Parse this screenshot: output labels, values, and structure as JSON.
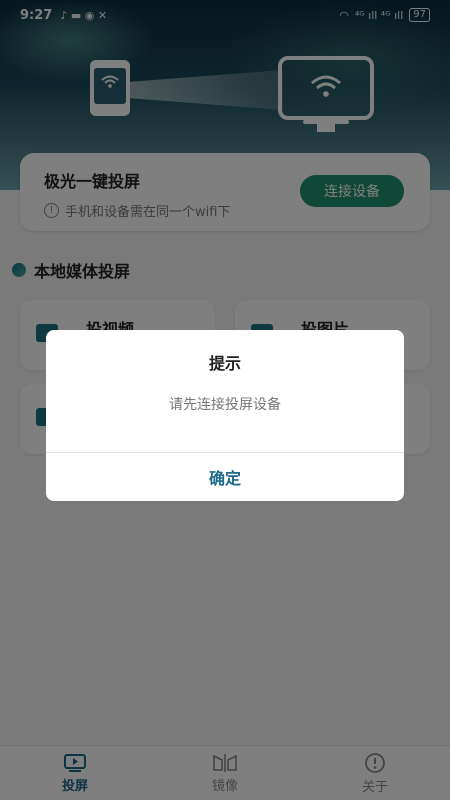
{
  "status_bar": {
    "time": "9:27",
    "mini_icons": "♪ ▬ ◉ ✕",
    "signal_text": "⁴ᴳ ıll ⁴ᴳ ıll",
    "battery": "97"
  },
  "header_card": {
    "title": "极光一键投屏",
    "tip": "手机和设备需在同一个wifi下",
    "connect_label": "连接设备"
  },
  "section": {
    "title": "本地媒体投屏"
  },
  "tiles": [
    {
      "label": "投视频"
    },
    {
      "label": "投图片"
    },
    {
      "label": ""
    },
    {
      "label": ""
    }
  ],
  "dialog": {
    "title": "提示",
    "message": "请先连接投屏设备",
    "confirm_label": "确定"
  },
  "tabbar": [
    {
      "label": "投屏",
      "icon": "cast-icon",
      "active": true
    },
    {
      "label": "镜像",
      "icon": "mirror-icon",
      "active": false
    },
    {
      "label": "关于",
      "icon": "info-icon",
      "active": false
    }
  ],
  "colors": {
    "accent": "#20906f",
    "tab_active": "#1d6a8a"
  }
}
